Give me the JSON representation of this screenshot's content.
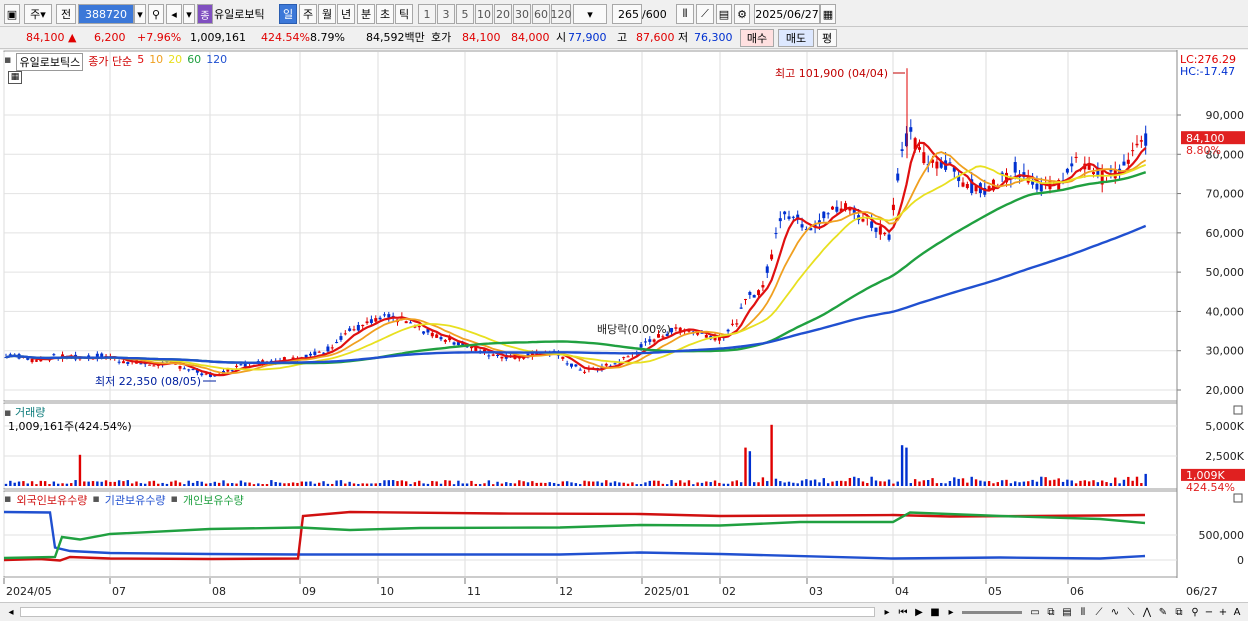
{
  "toolbar": {
    "market": "주",
    "market2": "전",
    "code": "388720",
    "stock_name": "유일로보틱",
    "stock_badge": "종",
    "periods": [
      "일",
      "주",
      "월",
      "년",
      "분",
      "초",
      "틱"
    ],
    "intervals": [
      "1",
      "3",
      "5",
      "10",
      "20",
      "30",
      "60",
      "120"
    ],
    "count": "265",
    "count_total": "/600",
    "date": "2025/06/27"
  },
  "quote": {
    "price": "84,100",
    "change_arrow": "▲",
    "change": "6,200",
    "change_pct": "+7.96%",
    "volume": "1,009,161",
    "volume_ratio": "424.54%",
    "turnover": "8.79%",
    "amount": "84,592백만",
    "bid_label": "호가",
    "ask_price": "84,100",
    "bid_price": "84,000",
    "open_label": "시",
    "open": "77,900",
    "high_label": "고",
    "high": "87,600",
    "low_label": "저",
    "low": "76,300",
    "buy_label": "매수",
    "sell_label": "매도",
    "eval_label": "평"
  },
  "price_pane": {
    "legend_name": "유일로보틱스",
    "legend_type": "종가 단순",
    "ma_labels": [
      {
        "label": "5",
        "color": "#e01010"
      },
      {
        "label": "10",
        "color": "#f0a020"
      },
      {
        "label": "20",
        "color": "#e8e020"
      },
      {
        "label": "60",
        "color": "#20a040"
      },
      {
        "label": "120",
        "color": "#2050d0"
      }
    ],
    "lc": "LC:276.29",
    "hc": "HC:-17.47",
    "current_price_tag": "84,100",
    "current_pct_tag": "8.80%",
    "y_ticks": [
      "90,000",
      "80,000",
      "70,000",
      "60,000",
      "50,000",
      "40,000",
      "30,000",
      "20,000"
    ],
    "annotations": {
      "high": "최고 101,900 (04/04)",
      "low": "최저 22,350 (08/05)",
      "dividend": "배당락(0.00%)"
    }
  },
  "volume_pane": {
    "title": "거래량",
    "value": "1,009,161주(424.54%)",
    "y_ticks": [
      "5,000K",
      "2,500K"
    ],
    "current_tag": "1,009K",
    "current_pct": "424.54%"
  },
  "holdings_pane": {
    "series": [
      {
        "label": "외국인보유수량",
        "color": "#d01010"
      },
      {
        "label": "기관보유수량",
        "color": "#2050d0"
      },
      {
        "label": "개인보유수량",
        "color": "#20a040"
      }
    ],
    "y_ticks": [
      "500,000",
      "0"
    ]
  },
  "x_axis": {
    "labels": [
      "2024/05",
      "07",
      "08",
      "09",
      "10",
      "11",
      "12",
      "2025/01",
      "02",
      "03",
      "04",
      "05",
      "06"
    ],
    "last_label": "06/27"
  },
  "colors": {
    "up": "#e00000",
    "down": "#0030d0",
    "grid": "#d8d8d8",
    "accent": "#3c78d8"
  }
}
